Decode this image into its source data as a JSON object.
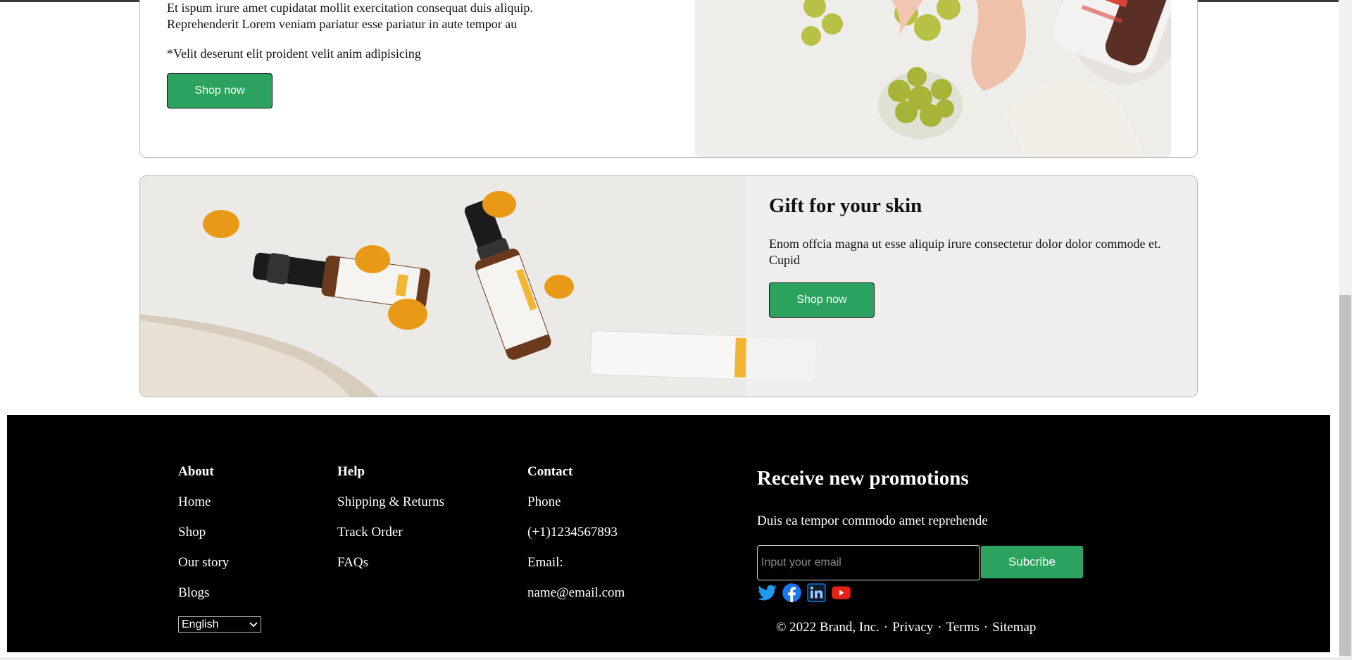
{
  "product_top": {
    "copy_lines": [
      "Et ispum irure amet cupidatat mollit exercitation consequat duis aliquip.",
      "Reprehenderit Lorem veniam pariatur esse pariatur in aute tempor au"
    ],
    "note": "*Velit deserunt elit proident velit anim adipisicing",
    "button_label": "Shop now"
  },
  "product_gift": {
    "title": "Gift for your skin",
    "description": "Enom offcia magna ut esse aliquip irure consectetur dolor dolor commode et. Cupid",
    "button_label": "Shop now"
  },
  "footer": {
    "about": {
      "heading": "About",
      "links": [
        "Home",
        "Shop",
        "Our story",
        "Blogs"
      ]
    },
    "help": {
      "heading": "Help",
      "links": [
        "Shipping & Returns",
        "Track Order",
        "FAQs"
      ]
    },
    "contact": {
      "heading": "Contact",
      "lines": [
        "Phone",
        "(+1)1234567893",
        "Email:",
        "name@email.com"
      ]
    },
    "language": {
      "selected": "English"
    },
    "newsletter": {
      "title": "Receive new promotions",
      "description": "Duis ea tempor commodo amet reprehende",
      "email_placeholder": "Input your email",
      "subscribe_label": "Subcribe"
    },
    "social_icons": [
      "twitter-icon",
      "facebook-icon",
      "linkedin-icon",
      "youtube-icon"
    ],
    "legal": {
      "copyright": "© 2022 Brand, Inc.",
      "links": [
        "Privacy",
        "Terms",
        "Sitemap"
      ],
      "separator": "·"
    }
  },
  "colors": {
    "accent_green": "#2ba35f",
    "footer_bg": "#000000",
    "twitter": "#1d9bf0",
    "facebook": "#1877f2",
    "linkedin": "#0a66c2",
    "youtube": "#e62117"
  }
}
